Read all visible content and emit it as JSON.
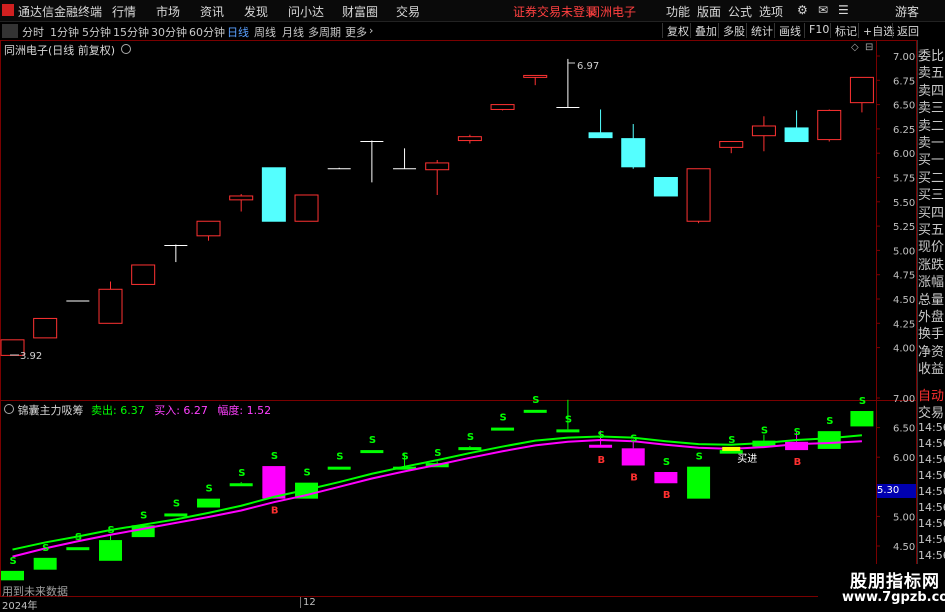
{
  "menubar": {
    "app_title": "通达信金融终端",
    "items": [
      "行情",
      "市场",
      "资讯",
      "发现",
      "问小达",
      "财富圈",
      "交易"
    ],
    "warning": "证券交易未登录",
    "stock": "同洲电子",
    "right_items": [
      "功能",
      "版面",
      "公式",
      "选项"
    ],
    "guest": "游客"
  },
  "periodbar": {
    "periods": [
      "分时",
      "1分钟",
      "5分钟",
      "15分钟",
      "30分钟",
      "60分钟",
      "日线",
      "周线",
      "月线",
      "多周期",
      "更多"
    ],
    "active": "日线",
    "tools": [
      "复权",
      "叠加",
      "多股",
      "统计",
      "画线",
      "F10",
      "标记",
      "+自选",
      "返回"
    ]
  },
  "main_panel": {
    "title": "同洲电子(日线 前复权)",
    "high_label": "6.97",
    "low_label": "3.92"
  },
  "sub_panel": {
    "indicator": "锦囊主力吸筹",
    "sell_label": "卖出: 6.37",
    "buy_label": "买入: 6.27",
    "amp_label": "幅度: 1.52",
    "buy_in_label": "买进",
    "price_tag": "5.30",
    "future_note": "用到未来数据"
  },
  "x_axis": {
    "year": "2024年",
    "month": "12"
  },
  "sidebar": {
    "labels": [
      "委比",
      "卖五",
      "卖四",
      "卖三",
      "卖二",
      "卖一",
      "买一",
      "买二",
      "买三",
      "买四",
      "买五",
      "现价",
      "涨跌",
      "涨幅",
      "总量",
      "外盘",
      "换手",
      "净资",
      "收益"
    ],
    "auto": "自动",
    "trade": "交易",
    "times": [
      "14:56",
      "14:56",
      "14:56",
      "14:56",
      "14:56",
      "14:56",
      "14:56",
      "14:56",
      "14:56",
      "14:56"
    ]
  },
  "watermark": {
    "title": "股朋指标网",
    "url": "www.7gpzb.com"
  },
  "colors": {
    "up": "#ff3232",
    "down": "#54ffff",
    "sell_line": "#00ff00",
    "buy_line": "#ff00ff",
    "border": "#7a0000"
  },
  "chart_data": [
    {
      "type": "candlestick",
      "title": "同洲电子(日线 前复权)",
      "y_ticks": [
        4.0,
        4.25,
        4.5,
        4.75,
        5.0,
        5.25,
        5.5,
        5.75,
        6.0,
        6.25,
        6.5,
        6.75,
        7.0
      ],
      "ylim": [
        3.84,
        7.12
      ],
      "annotations": [
        {
          "text": "6.97",
          "index": 17
        },
        {
          "text": "3.92",
          "index": 0
        }
      ],
      "candles": [
        {
          "o": 3.92,
          "h": 4.08,
          "l": 3.92,
          "c": 4.08
        },
        {
          "o": 4.1,
          "h": 4.3,
          "l": 4.1,
          "c": 4.3
        },
        {
          "o": 4.48,
          "h": 4.48,
          "l": 4.48,
          "c": 4.48
        },
        {
          "o": 4.25,
          "h": 4.68,
          "l": 4.25,
          "c": 4.6
        },
        {
          "o": 4.65,
          "h": 4.85,
          "l": 4.65,
          "c": 4.85
        },
        {
          "o": 5.05,
          "h": 5.06,
          "l": 4.88,
          "c": 5.05
        },
        {
          "o": 5.15,
          "h": 5.3,
          "l": 5.1,
          "c": 5.3
        },
        {
          "o": 5.52,
          "h": 5.58,
          "l": 5.4,
          "c": 5.56
        },
        {
          "o": 5.85,
          "h": 5.85,
          "l": 5.3,
          "c": 5.3
        },
        {
          "o": 5.3,
          "h": 5.57,
          "l": 5.3,
          "c": 5.57
        },
        {
          "o": 5.84,
          "h": 5.85,
          "l": 5.84,
          "c": 5.84
        },
        {
          "o": 6.12,
          "h": 6.13,
          "l": 5.7,
          "c": 6.12
        },
        {
          "o": 5.84,
          "h": 6.05,
          "l": 5.84,
          "c": 5.84
        },
        {
          "o": 5.83,
          "h": 5.93,
          "l": 5.57,
          "c": 5.9
        },
        {
          "o": 6.13,
          "h": 6.19,
          "l": 6.1,
          "c": 6.17
        },
        {
          "o": 6.45,
          "h": 6.5,
          "l": 6.44,
          "c": 6.5
        },
        {
          "o": 6.78,
          "h": 6.8,
          "l": 6.7,
          "c": 6.8
        },
        {
          "o": 6.47,
          "h": 6.97,
          "l": 6.47,
          "c": 6.47
        },
        {
          "o": 6.21,
          "h": 6.45,
          "l": 6.16,
          "c": 6.16
        },
        {
          "o": 6.15,
          "h": 6.3,
          "l": 5.84,
          "c": 5.86
        },
        {
          "o": 5.75,
          "h": 5.75,
          "l": 5.56,
          "c": 5.56
        },
        {
          "o": 5.3,
          "h": 5.84,
          "l": 5.28,
          "c": 5.84
        },
        {
          "o": 6.06,
          "h": 6.12,
          "l": 6.0,
          "c": 6.12
        },
        {
          "o": 6.18,
          "h": 6.38,
          "l": 6.02,
          "c": 6.28
        },
        {
          "o": 6.26,
          "h": 6.44,
          "l": 6.12,
          "c": 6.12
        },
        {
          "o": 6.14,
          "h": 6.45,
          "l": 6.12,
          "c": 6.44
        },
        {
          "o": 6.52,
          "h": 6.77,
          "l": 6.42,
          "c": 6.78
        }
      ]
    },
    {
      "type": "indicator",
      "title": "锦囊主力吸筹",
      "y_ticks": [
        4.5,
        5.0,
        5.5,
        6.0,
        6.5,
        7.0
      ],
      "ylim": [
        4.25,
        7.25
      ],
      "series": [
        {
          "name": "卖出",
          "values": [
            4.44,
            4.56,
            4.66,
            4.77,
            4.86,
            4.95,
            5.06,
            5.18,
            5.33,
            5.45,
            5.58,
            5.72,
            5.84,
            5.95,
            6.07,
            6.18,
            6.28,
            6.33,
            6.35,
            6.33,
            6.27,
            6.22,
            6.21,
            6.24,
            6.29,
            6.32,
            6.37
          ]
        },
        {
          "name": "买入",
          "values": [
            4.32,
            4.46,
            4.58,
            4.69,
            4.79,
            4.89,
            4.99,
            5.1,
            5.24,
            5.36,
            5.5,
            5.64,
            5.76,
            5.87,
            5.99,
            6.1,
            6.2,
            6.26,
            6.29,
            6.27,
            6.21,
            6.16,
            6.14,
            6.17,
            6.22,
            6.24,
            6.27
          ]
        }
      ],
      "buy_in_index": 22
    }
  ]
}
